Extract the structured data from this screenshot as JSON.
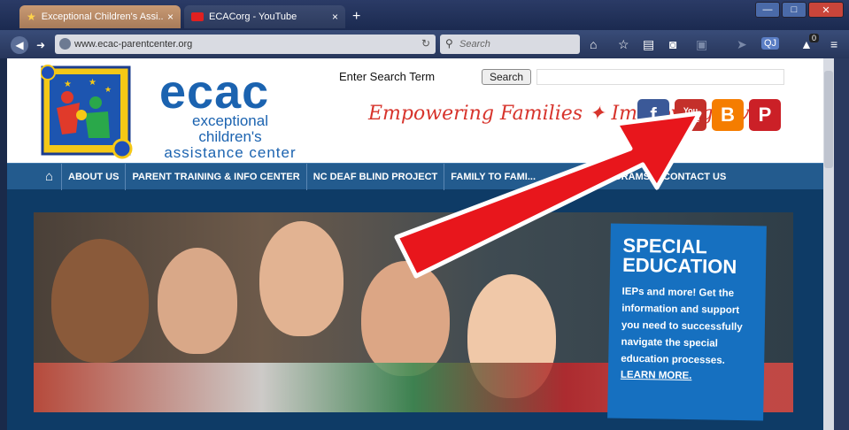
{
  "browser": {
    "tabs": [
      {
        "label": "Exceptional Children's Assi...",
        "close": "×"
      },
      {
        "label": "ECACorg - YouTube",
        "close": "×"
      }
    ],
    "new_tab": "+",
    "url": "www.ecac-parentcenter.org",
    "search_placeholder": "Search",
    "window_buttons": {
      "minimize": "—",
      "maximize": "□",
      "close": "✕"
    },
    "badge_count": "0"
  },
  "site": {
    "logo_text": "ecac",
    "logo_subtitle": [
      "exceptional children's",
      "assistance center"
    ],
    "search_label": "Enter Search Term",
    "search_button": "Search",
    "tagline": "Empowering Families ✦ Improving Lives",
    "social": {
      "facebook": "f",
      "youtube_top": "You",
      "youtube_bottom": "Tube",
      "blogger": "B",
      "pinterest": "P"
    },
    "nav": [
      "ABOUT US",
      "PARENT TRAINING & INFO CENTER",
      "NC DEAF BLIND PROJECT",
      "FAMILY TO FAMI...",
      "PROGRAMS",
      "CONTACT US"
    ],
    "promo": {
      "title_1": "SPECIAL",
      "title_2": "EDUCATION",
      "body": "IEPs and more! Get the information and support you need to successfully navigate the special education processes.",
      "link": "LEARN MORE."
    }
  },
  "colors": {
    "accent_red": "#e8161c",
    "nav_blue": "#235b8e",
    "brand_blue": "#1b63b0"
  }
}
